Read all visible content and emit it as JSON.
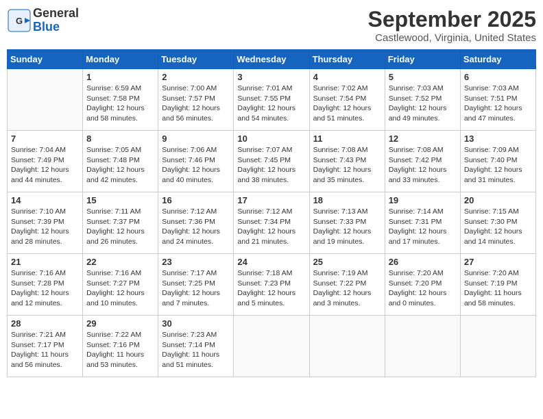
{
  "header": {
    "logo_general": "General",
    "logo_blue": "Blue",
    "month": "September 2025",
    "location": "Castlewood, Virginia, United States"
  },
  "weekdays": [
    "Sunday",
    "Monday",
    "Tuesday",
    "Wednesday",
    "Thursday",
    "Friday",
    "Saturday"
  ],
  "weeks": [
    [
      {
        "day": "",
        "info": ""
      },
      {
        "day": "1",
        "info": "Sunrise: 6:59 AM\nSunset: 7:58 PM\nDaylight: 12 hours\nand 58 minutes."
      },
      {
        "day": "2",
        "info": "Sunrise: 7:00 AM\nSunset: 7:57 PM\nDaylight: 12 hours\nand 56 minutes."
      },
      {
        "day": "3",
        "info": "Sunrise: 7:01 AM\nSunset: 7:55 PM\nDaylight: 12 hours\nand 54 minutes."
      },
      {
        "day": "4",
        "info": "Sunrise: 7:02 AM\nSunset: 7:54 PM\nDaylight: 12 hours\nand 51 minutes."
      },
      {
        "day": "5",
        "info": "Sunrise: 7:03 AM\nSunset: 7:52 PM\nDaylight: 12 hours\nand 49 minutes."
      },
      {
        "day": "6",
        "info": "Sunrise: 7:03 AM\nSunset: 7:51 PM\nDaylight: 12 hours\nand 47 minutes."
      }
    ],
    [
      {
        "day": "7",
        "info": "Sunrise: 7:04 AM\nSunset: 7:49 PM\nDaylight: 12 hours\nand 44 minutes."
      },
      {
        "day": "8",
        "info": "Sunrise: 7:05 AM\nSunset: 7:48 PM\nDaylight: 12 hours\nand 42 minutes."
      },
      {
        "day": "9",
        "info": "Sunrise: 7:06 AM\nSunset: 7:46 PM\nDaylight: 12 hours\nand 40 minutes."
      },
      {
        "day": "10",
        "info": "Sunrise: 7:07 AM\nSunset: 7:45 PM\nDaylight: 12 hours\nand 38 minutes."
      },
      {
        "day": "11",
        "info": "Sunrise: 7:08 AM\nSunset: 7:43 PM\nDaylight: 12 hours\nand 35 minutes."
      },
      {
        "day": "12",
        "info": "Sunrise: 7:08 AM\nSunset: 7:42 PM\nDaylight: 12 hours\nand 33 minutes."
      },
      {
        "day": "13",
        "info": "Sunrise: 7:09 AM\nSunset: 7:40 PM\nDaylight: 12 hours\nand 31 minutes."
      }
    ],
    [
      {
        "day": "14",
        "info": "Sunrise: 7:10 AM\nSunset: 7:39 PM\nDaylight: 12 hours\nand 28 minutes."
      },
      {
        "day": "15",
        "info": "Sunrise: 7:11 AM\nSunset: 7:37 PM\nDaylight: 12 hours\nand 26 minutes."
      },
      {
        "day": "16",
        "info": "Sunrise: 7:12 AM\nSunset: 7:36 PM\nDaylight: 12 hours\nand 24 minutes."
      },
      {
        "day": "17",
        "info": "Sunrise: 7:12 AM\nSunset: 7:34 PM\nDaylight: 12 hours\nand 21 minutes."
      },
      {
        "day": "18",
        "info": "Sunrise: 7:13 AM\nSunset: 7:33 PM\nDaylight: 12 hours\nand 19 minutes."
      },
      {
        "day": "19",
        "info": "Sunrise: 7:14 AM\nSunset: 7:31 PM\nDaylight: 12 hours\nand 17 minutes."
      },
      {
        "day": "20",
        "info": "Sunrise: 7:15 AM\nSunset: 7:30 PM\nDaylight: 12 hours\nand 14 minutes."
      }
    ],
    [
      {
        "day": "21",
        "info": "Sunrise: 7:16 AM\nSunset: 7:28 PM\nDaylight: 12 hours\nand 12 minutes."
      },
      {
        "day": "22",
        "info": "Sunrise: 7:16 AM\nSunset: 7:27 PM\nDaylight: 12 hours\nand 10 minutes."
      },
      {
        "day": "23",
        "info": "Sunrise: 7:17 AM\nSunset: 7:25 PM\nDaylight: 12 hours\nand 7 minutes."
      },
      {
        "day": "24",
        "info": "Sunrise: 7:18 AM\nSunset: 7:23 PM\nDaylight: 12 hours\nand 5 minutes."
      },
      {
        "day": "25",
        "info": "Sunrise: 7:19 AM\nSunset: 7:22 PM\nDaylight: 12 hours\nand 3 minutes."
      },
      {
        "day": "26",
        "info": "Sunrise: 7:20 AM\nSunset: 7:20 PM\nDaylight: 12 hours\nand 0 minutes."
      },
      {
        "day": "27",
        "info": "Sunrise: 7:20 AM\nSunset: 7:19 PM\nDaylight: 11 hours\nand 58 minutes."
      }
    ],
    [
      {
        "day": "28",
        "info": "Sunrise: 7:21 AM\nSunset: 7:17 PM\nDaylight: 11 hours\nand 56 minutes."
      },
      {
        "day": "29",
        "info": "Sunrise: 7:22 AM\nSunset: 7:16 PM\nDaylight: 11 hours\nand 53 minutes."
      },
      {
        "day": "30",
        "info": "Sunrise: 7:23 AM\nSunset: 7:14 PM\nDaylight: 11 hours\nand 51 minutes."
      },
      {
        "day": "",
        "info": ""
      },
      {
        "day": "",
        "info": ""
      },
      {
        "day": "",
        "info": ""
      },
      {
        "day": "",
        "info": ""
      }
    ]
  ]
}
